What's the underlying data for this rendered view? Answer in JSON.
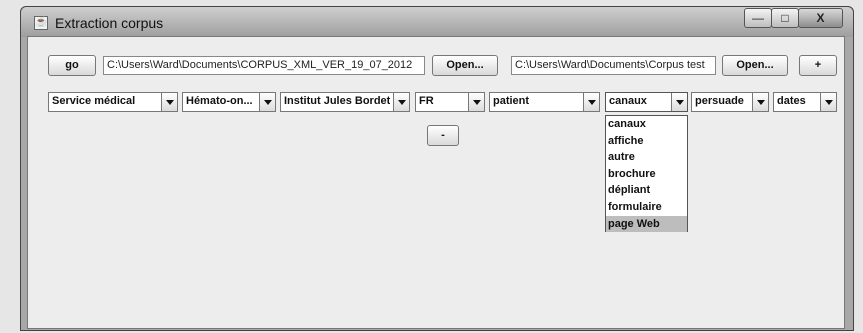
{
  "window": {
    "title": "Extraction corpus",
    "buttons": {
      "minimize": "—",
      "maximize": "□",
      "close": "X"
    }
  },
  "top_row": {
    "go_label": "go",
    "corpus_path": "C:\\Users\\Ward\\Documents\\CORPUS_XML_VER_19_07_2012",
    "open_label_1": "Open...",
    "output_path": "C:\\Users\\Ward\\Documents\\Corpus test",
    "open_label_2": "Open...",
    "add_label": "+"
  },
  "filters": [
    {
      "value": "Service médical"
    },
    {
      "value": "Hémato-on..."
    },
    {
      "value": "Institut Jules Bordet"
    },
    {
      "value": "FR"
    },
    {
      "value": "patient"
    },
    {
      "value": "canaux"
    },
    {
      "value": "persuade"
    },
    {
      "value": "dates"
    }
  ],
  "remove_label": "-",
  "dropdown": {
    "options": [
      "canaux",
      "affiche",
      "autre",
      "brochure",
      "dépliant",
      "formulaire",
      "page Web"
    ],
    "highlighted": "page Web"
  }
}
